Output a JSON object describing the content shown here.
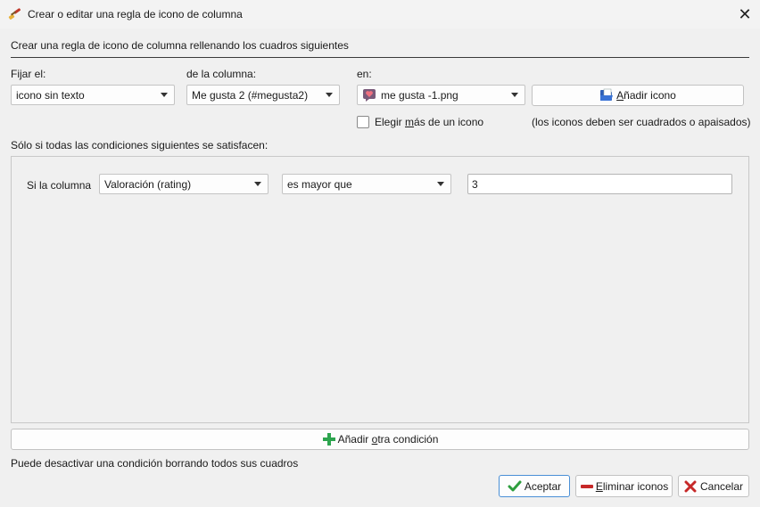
{
  "window": {
    "title": "Crear o editar una regla de icono de columna",
    "app_icon": "paintbrush-icon",
    "close_icon": "close-icon"
  },
  "heading": "Crear una regla de icono de columna rellenando los cuadros siguientes",
  "fijar": {
    "label": "Fijar el:",
    "value": "icono sin texto"
  },
  "columna": {
    "label": "de la columna:",
    "value": "Me gusta 2 (#megusta2)"
  },
  "en": {
    "label": "en:",
    "value": "me gusta -1.png",
    "icon": "heart-bubble-icon"
  },
  "add_icon_button": {
    "label_pre": "",
    "label_u": "A",
    "label_post": "ñadir icono",
    "icon": "folder-open-icon"
  },
  "multi_icon": {
    "label_pre": "Elegir ",
    "label_u": "m",
    "label_post": "ás de un icono",
    "checked": false
  },
  "icons_note": "(los iconos deben ser cuadrados o apaisados)",
  "conditions_label": "Sólo si todas las condiciones siguientes se satisfacen:",
  "condition": {
    "prefix": "Si la columna",
    "column": "Valoración (rating)",
    "operator": "es mayor que",
    "value": "3"
  },
  "add_condition_button": {
    "label_pre": "Añadir ",
    "label_u": "o",
    "label_post": "tra condición",
    "icon": "plus-icon"
  },
  "footer_note": "Puede desactivar una condición borrando todos sus cuadros",
  "buttons": {
    "accept": {
      "label": "Aceptar",
      "icon": "checkmark-icon"
    },
    "remove": {
      "label_u": "E",
      "label_post": "liminar iconos",
      "icon": "minus-icon"
    },
    "cancel": {
      "label": "Cancelar",
      "icon": "x-icon"
    }
  },
  "colors": {
    "accent": "#4a8fd6",
    "plus_green": "#2da44e",
    "check_green": "#2e9e3e",
    "minus_red": "#c62828",
    "x_red": "#c62828"
  }
}
